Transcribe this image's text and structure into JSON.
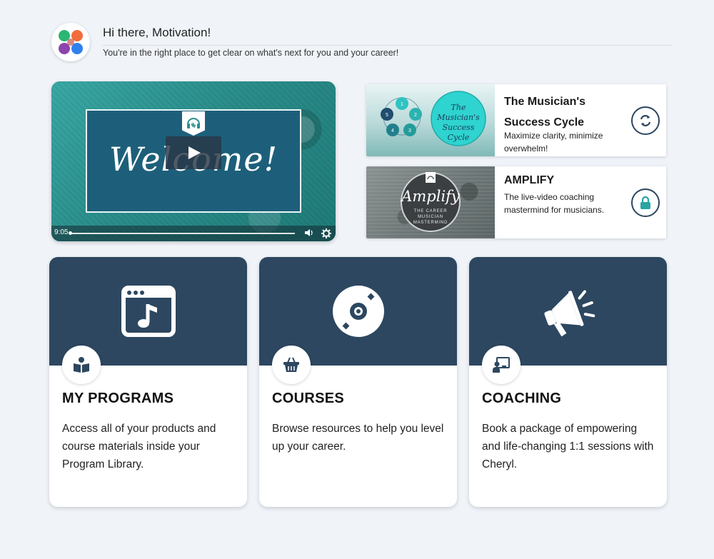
{
  "header": {
    "greeting": "Hi there, Motivation!",
    "subtitle": "You're in the right place to get clear on what's next for you and your career!"
  },
  "video": {
    "title": "Welcome!",
    "time": "9:05",
    "icons": [
      "headphones-icon",
      "play-icon",
      "volume-icon",
      "gear-icon"
    ]
  },
  "programs": [
    {
      "title": "The Musician's Success Cycle",
      "description": "Maximize clarity, minimize overwhelm!",
      "thumb_text": "The Musician's Success Cycle",
      "cycle_numbers": [
        "1",
        "2",
        "3",
        "4",
        "5"
      ],
      "icon": "refresh-icon"
    },
    {
      "title": "AMPLIFY",
      "description": "The live-video coaching mastermind for musicians.",
      "thumb_text": "Amplify",
      "thumb_subtext": "THE CAREER MUSICIAN MASTERMIND",
      "icon": "lock-icon"
    }
  ],
  "cards": [
    {
      "title": "MY PROGRAMS",
      "description": "Access all of your products and course materials inside your Program Library.",
      "icon": "music-window-icon",
      "badge_icon": "open-book-icon"
    },
    {
      "title": "COURSES",
      "description": "Browse resources to help you level up your career.",
      "icon": "disc-icon",
      "badge_icon": "basket-icon"
    },
    {
      "title": "COACHING",
      "description": "Book a package of empowering and life-changing 1:1 sessions with Cheryl.",
      "icon": "megaphone-icon",
      "badge_icon": "presenter-icon"
    }
  ],
  "colors": {
    "background": "#f0f4f9",
    "card_header": "#2d4760",
    "teal": "#2aa5a3",
    "button_border": "#2c4560"
  }
}
